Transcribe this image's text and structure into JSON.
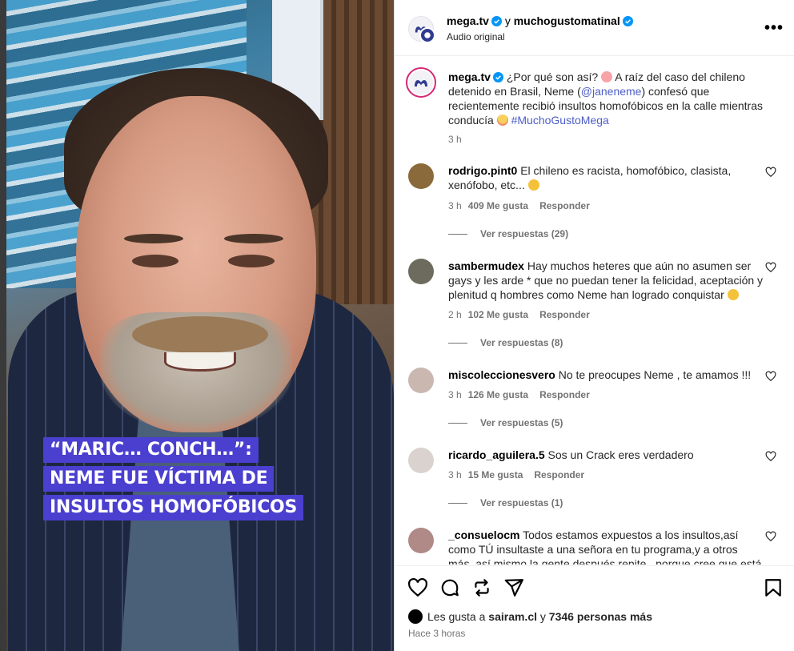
{
  "video": {
    "caption_lines": [
      "“MARIC… CONCH…”:",
      "NEME FUE VÍCTIMA DE",
      "INSULTOS HOMOFÓBICOS"
    ]
  },
  "header": {
    "account": "mega.tv",
    "joiner": "y",
    "collab_account": "muchogustomatinal",
    "audio": "Audio original",
    "more_icon": "more-horizontal-icon"
  },
  "caption": {
    "user": "mega.tv",
    "text_1": "¿Por qué son así?",
    "text_2": "A raíz del caso del chileno detenido en Brasil, Neme (",
    "mention": "@janeneme",
    "text_3": ") confesó que recientemente recibió insultos homofóbicos en la calle mientras conducía",
    "hashtag": "#MuchoGustoMega",
    "time": "3 h"
  },
  "comments": [
    {
      "user": "rodrigo.pint0",
      "text": "El chileno es racista, homofóbico, clasista, xenófobo, etc...",
      "time": "3 h",
      "likes": "409 Me gusta",
      "reply": "Responder",
      "replies": "Ver respuestas (29)",
      "avatar_color": "#8a6a3a"
    },
    {
      "user": "sambermudex",
      "text": "Hay muchos heteres que aún no asumen ser gays y les arde * que no puedan tener la felicidad, aceptación y plenitud q hombres como Neme han logrado conquistar",
      "time": "2 h",
      "likes": "102 Me gusta",
      "reply": "Responder",
      "replies": "Ver respuestas (8)",
      "avatar_color": "#6d6a5e"
    },
    {
      "user": "miscoleccionesvero",
      "text": "No te preocupes Neme , te amamos !!!",
      "time": "3 h",
      "likes": "126 Me gusta",
      "reply": "Responder",
      "replies": "Ver respuestas (5)",
      "avatar_color": "#c9b7b0"
    },
    {
      "user": "ricardo_aguilera.5",
      "text": "Sos un Crack eres verdadero",
      "time": "3 h",
      "likes": "15 Me gusta",
      "reply": "Responder",
      "replies": "Ver respuestas (1)",
      "avatar_color": "#d9d2cf"
    },
    {
      "user": "_consuelocm",
      "text": "Todos estamos expuestos a los insultos,así como TÚ insultaste a una señora en tu programa,y a otros más, así mismo la gente después repite , porque cree que está",
      "avatar_color": "#b08a86"
    }
  ],
  "actions": {
    "like_icon": "heart-icon",
    "comment_icon": "comment-icon",
    "share_icon": "repost-icon",
    "send_icon": "send-icon",
    "save_icon": "bookmark-icon",
    "likes_prefix": "Les gusta a",
    "likes_user": "sairam.cl",
    "likes_joiner": "y",
    "likes_rest": "7346 personas más",
    "time": "Hace 3 horas"
  },
  "colors": {
    "accent_link": "#4d5dc7",
    "verified": "#0095f6",
    "caption_bg": "#4b3fd0"
  }
}
